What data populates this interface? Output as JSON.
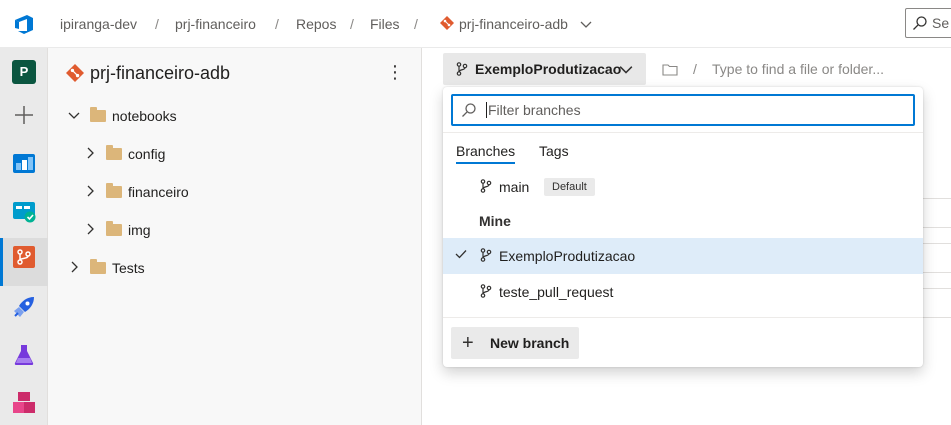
{
  "breadcrumb": {
    "org": "ipiranga-dev",
    "project": "prj-financeiro",
    "section": "Repos",
    "subsection": "Files",
    "repo": "prj-financeiro-adb"
  },
  "search": {
    "placeholder": "Se"
  },
  "nav": {
    "project_initial": "P",
    "items": [
      "add-icon",
      "boards-icon",
      "test-plans-icon",
      "repos-icon",
      "pipelines-icon",
      "test-flask-icon",
      "artifacts-icon"
    ]
  },
  "tree": {
    "repo_title": "prj-financeiro-adb",
    "items": [
      {
        "label": "notebooks",
        "expanded": true
      },
      {
        "label": "config",
        "expanded": false
      },
      {
        "label": "financeiro",
        "expanded": false
      },
      {
        "label": "img",
        "expanded": false
      },
      {
        "label": "Tests",
        "expanded": false
      }
    ]
  },
  "main": {
    "current_branch": "ExemploProdutizacao",
    "path_separator": "/",
    "path_placeholder": "Type to find a file or folder..."
  },
  "branch_dropdown": {
    "filter_placeholder": "Filter branches",
    "tabs": [
      "Branches",
      "Tags"
    ],
    "active_tab": "Branches",
    "default_branch": {
      "name": "main",
      "badge": "Default"
    },
    "mine_heading": "Mine",
    "mine": [
      {
        "name": "ExemploProdutizacao",
        "selected": true
      },
      {
        "name": "teste_pull_request",
        "selected": false
      }
    ],
    "new_branch_label": "New branch"
  },
  "colors": {
    "accent": "#0078d4",
    "selected_row": "#deecf9",
    "folder": "#dcb67a",
    "repo_icon": "#e05b2f",
    "project_avatar": "#0b5640"
  }
}
